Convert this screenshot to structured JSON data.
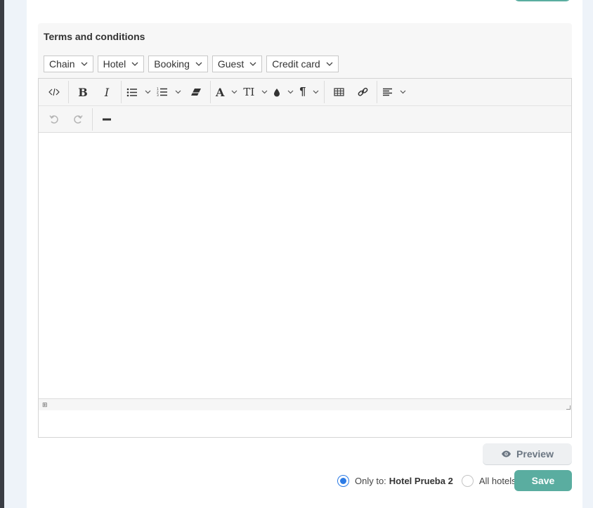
{
  "section": {
    "title": "Terms and conditions"
  },
  "variables": [
    {
      "label": "Chain"
    },
    {
      "label": "Hotel"
    },
    {
      "label": "Booking"
    },
    {
      "label": "Guest"
    },
    {
      "label": "Credit card"
    }
  ],
  "toolbar": {
    "code_view_icon": "code-icon",
    "bold_label": "B",
    "italic_label": "I",
    "font_label": "A",
    "font_size_label": "TI",
    "paragraph_label": "¶",
    "disabled_color": "#b5b5b5"
  },
  "editor": {
    "content": ""
  },
  "actions": {
    "preview_label": "Preview",
    "scope_only_prefix": "Only to:",
    "scope_hotel_name": "Hotel Prueba 2",
    "scope_all_label": "All hotels",
    "scope_selected": "only",
    "save_label": "Save"
  },
  "colors": {
    "accent": "#5aada0",
    "radio_selected": "#2c7be5",
    "preview_text": "#6b7682"
  }
}
